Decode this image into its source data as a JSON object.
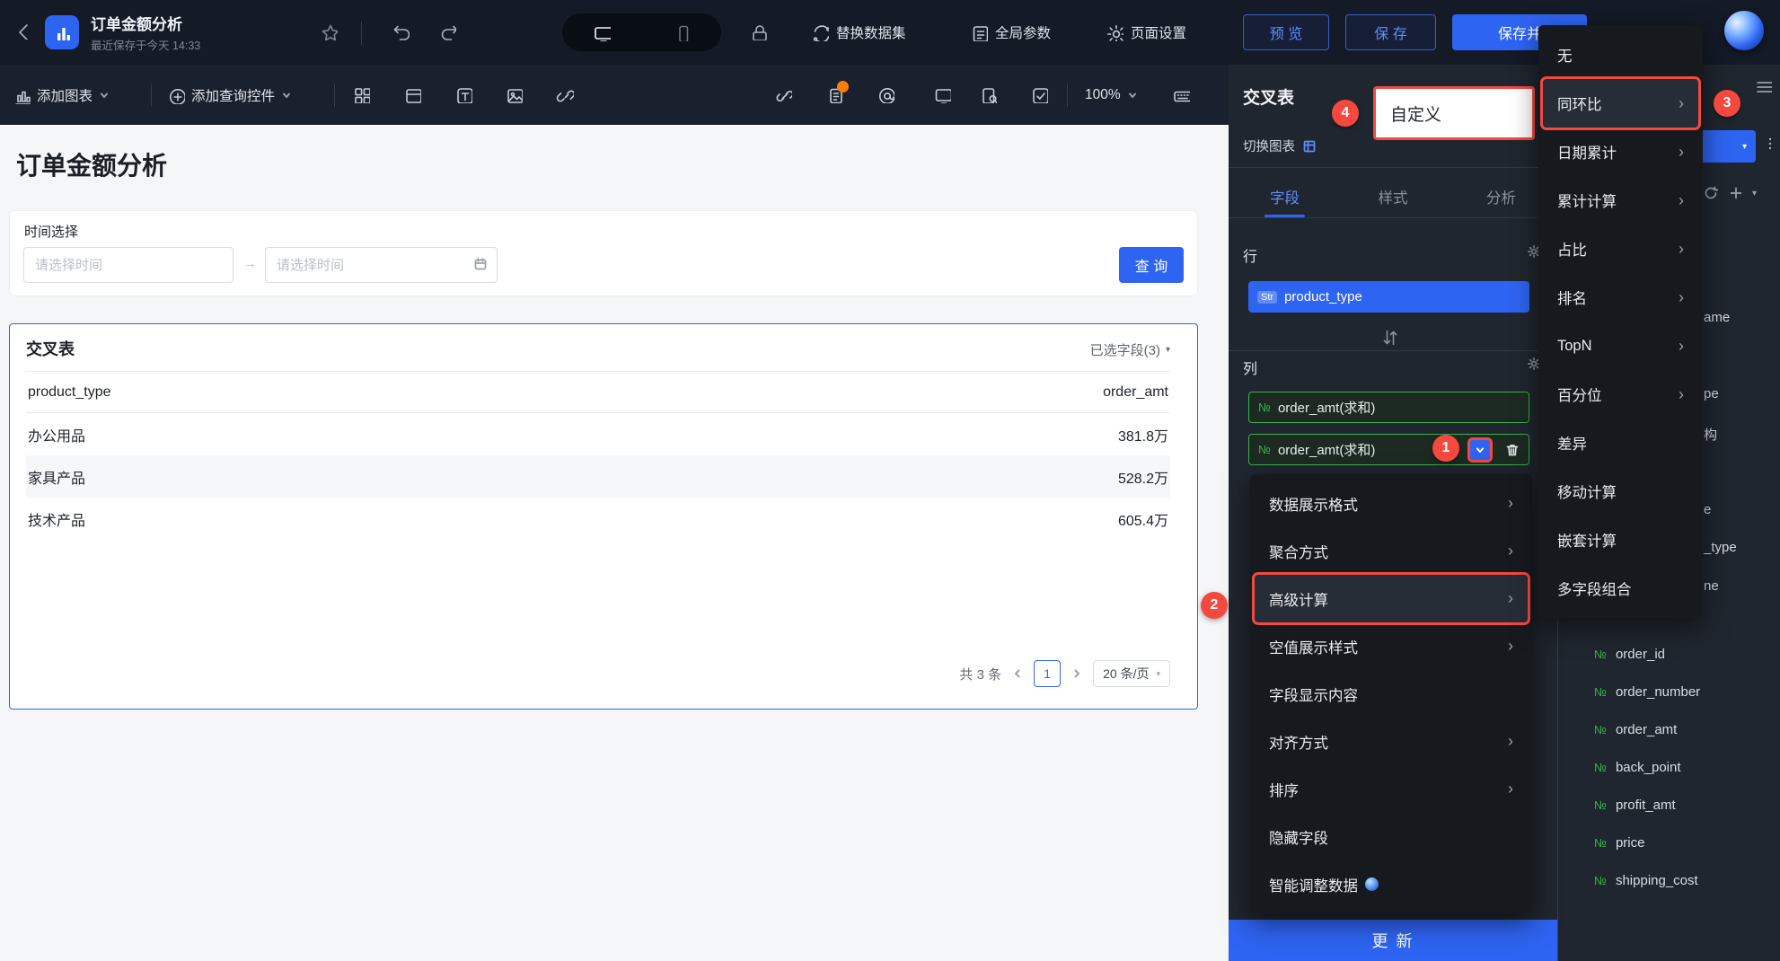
{
  "topbar": {
    "title": "订单金额分析",
    "subtitle": "最近保存于今天 14:33",
    "replace_dataset": "替换数据集",
    "global_params": "全局参数",
    "page_settings": "页面设置",
    "preview": "预 览",
    "save": "保 存",
    "save_publish": "保存并"
  },
  "toolbar": {
    "add_chart": "添加图表",
    "add_query": "添加查询控件",
    "zoom": "100%"
  },
  "canvas": {
    "title": "订单金额分析",
    "time_label": "时间选择",
    "date_placeholder_start": "请选择时间",
    "date_placeholder_end": "请选择时间",
    "query_button": "查 询",
    "table": {
      "title": "交叉表",
      "selected_fields": "已选字段(3)",
      "col1": "product_type",
      "col2": "order_amt",
      "rows": [
        {
          "type": "办公用品",
          "amt": "381.8万"
        },
        {
          "type": "家具产品",
          "amt": "528.2万"
        },
        {
          "type": "技术产品",
          "amt": "605.4万"
        }
      ],
      "total": "共 3 条",
      "page": "1",
      "page_size": "20 条/页"
    }
  },
  "panel": {
    "chart_type": "交叉表",
    "switch_chart": "切换图表",
    "tabs": {
      "fields": "字段",
      "style": "样式",
      "analysis": "分析"
    },
    "row_label": "行",
    "col_label": "列",
    "row_chip": {
      "tag": "Str",
      "name": "product_type"
    },
    "col_chip1": {
      "tag": "№",
      "name": "order_amt(求和)"
    },
    "col_chip2": {
      "tag": "№",
      "name": "order_amt(求和)"
    },
    "update": "更 新"
  },
  "context_menu": {
    "items": [
      {
        "label": "数据展示格式"
      },
      {
        "label": "聚合方式"
      },
      {
        "label": "高级计算"
      },
      {
        "label": "空值展示样式"
      },
      {
        "label": "字段显示内容"
      },
      {
        "label": "对齐方式"
      },
      {
        "label": "排序"
      },
      {
        "label": "隐藏字段"
      },
      {
        "label": "智能调整数据"
      }
    ]
  },
  "submenu": {
    "items": [
      {
        "label": "无"
      },
      {
        "label": "同环比"
      },
      {
        "label": "日期累计"
      },
      {
        "label": "累计计算"
      },
      {
        "label": "占比"
      },
      {
        "label": "排名"
      },
      {
        "label": "TopN"
      },
      {
        "label": "百分位"
      },
      {
        "label": "差异"
      },
      {
        "label": "移动计算"
      },
      {
        "label": "嵌套计算"
      },
      {
        "label": "多字段组合"
      }
    ]
  },
  "overlay": {
    "custom_label": "自定义"
  },
  "dataset": {
    "field_icon": "№",
    "fields": [
      "order_id",
      "order_number",
      "order_amt",
      "back_point",
      "profit_amt",
      "price",
      "shipping_cost"
    ],
    "fragments": [
      "ame",
      "pe",
      "构",
      "e",
      "_type",
      "ne"
    ]
  },
  "badges": {
    "b1": "1",
    "b2": "2",
    "b3": "3",
    "b4": "4"
  },
  "colors": {
    "accent": "#2e64f2",
    "annotation": "#f5483f",
    "green": "#37b24d"
  }
}
